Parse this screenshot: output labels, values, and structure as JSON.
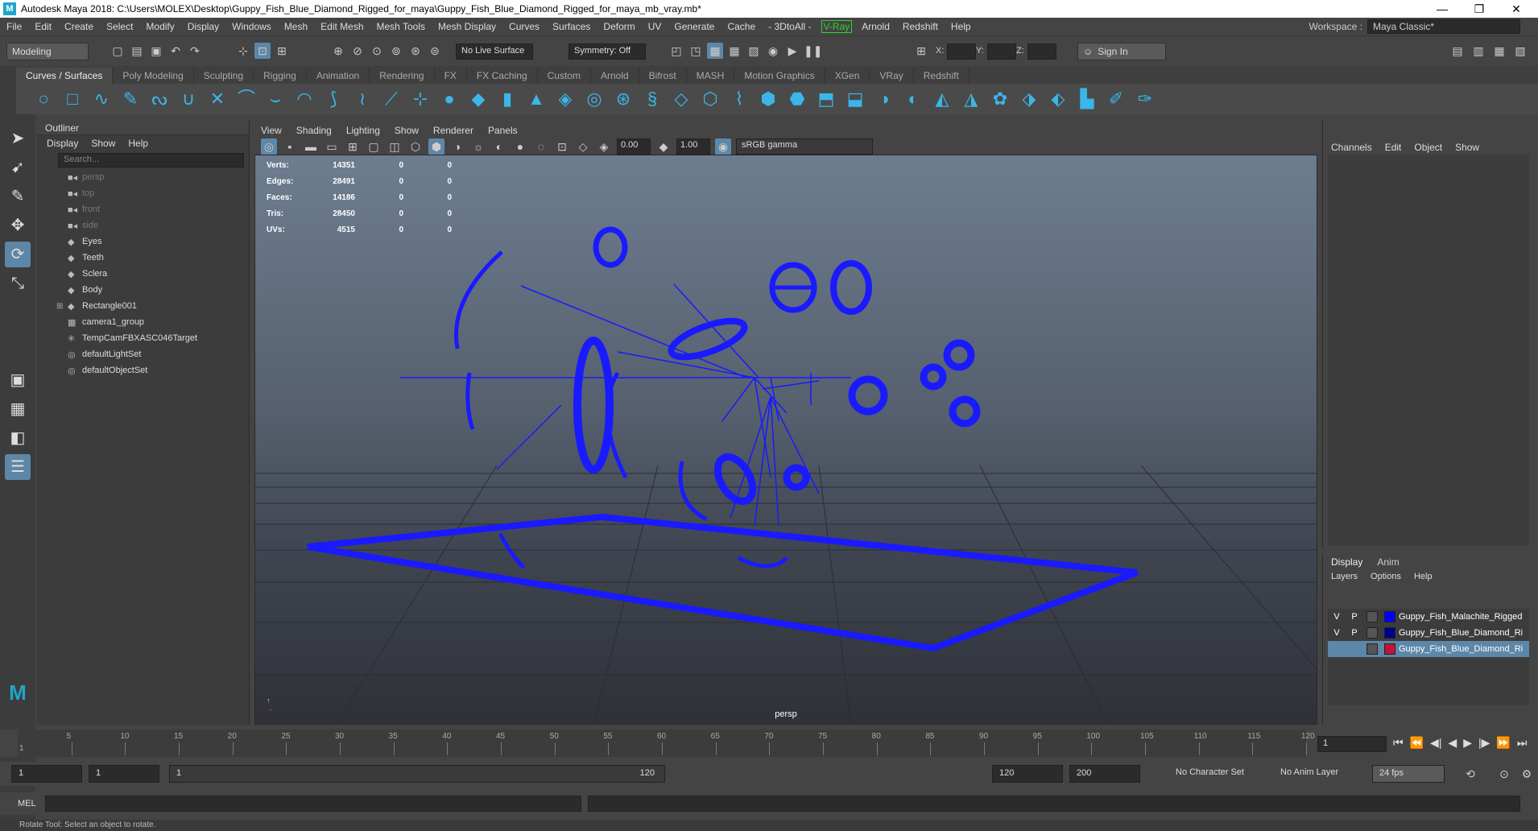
{
  "titlebar": {
    "title": "Autodesk Maya 2018: C:\\Users\\MOLEX\\Desktop\\Guppy_Fish_Blue_Diamond_Rigged_for_maya\\Guppy_Fish_Blue_Diamond_Rigged_for_maya_mb_vray.mb*",
    "minimize": "—",
    "restore": "❐",
    "close": "✕"
  },
  "menubar": {
    "items": [
      "File",
      "Edit",
      "Create",
      "Select",
      "Modify",
      "Display",
      "Windows",
      "Mesh",
      "Edit Mesh",
      "Mesh Tools",
      "Mesh Display",
      "Curves",
      "Surfaces",
      "Deform",
      "UV",
      "Generate",
      "Cache",
      "- 3DtoAll -",
      "V-Ray",
      "Arnold",
      "Redshift",
      "Help"
    ],
    "workspace_label": "Workspace :",
    "workspace_value": "Maya Classic*"
  },
  "statusline": {
    "mode": "Modeling",
    "live_surface": "No Live Surface",
    "symmetry": "Symmetry: Off",
    "x_label": "X:",
    "y_label": "Y:",
    "z_label": "Z:",
    "sign_in": "Sign In"
  },
  "shelf": {
    "tabs": [
      "Curves / Surfaces",
      "Poly Modeling",
      "Sculpting",
      "Rigging",
      "Animation",
      "Rendering",
      "FX",
      "FX Caching",
      "Custom",
      "Arnold",
      "Bifrost",
      "MASH",
      "Motion Graphics",
      "XGen",
      "VRay",
      "Redshift"
    ],
    "active_tab": "Curves / Surfaces"
  },
  "outliner": {
    "title": "Outliner",
    "menu": [
      "Display",
      "Show",
      "Help"
    ],
    "search_placeholder": "Search...",
    "items": [
      {
        "label": "persp",
        "dim": true,
        "icon": "camera-icon"
      },
      {
        "label": "top",
        "dim": true,
        "icon": "camera-icon"
      },
      {
        "label": "front",
        "dim": true,
        "icon": "camera-icon"
      },
      {
        "label": "side",
        "dim": true,
        "icon": "camera-icon"
      },
      {
        "label": "Eyes",
        "dim": false,
        "icon": "transform-icon"
      },
      {
        "label": "Teeth",
        "dim": false,
        "icon": "transform-icon"
      },
      {
        "label": "Sclera",
        "dim": false,
        "icon": "transform-icon"
      },
      {
        "label": "Body",
        "dim": false,
        "icon": "transform-icon"
      },
      {
        "label": "Rectangle001",
        "dim": false,
        "icon": "transform-icon",
        "expandable": true
      },
      {
        "label": "camera1_group",
        "dim": false,
        "icon": "group-icon"
      },
      {
        "label": "TempCamFBXASC046Target",
        "dim": false,
        "icon": "locator-icon"
      },
      {
        "label": "defaultLightSet",
        "dim": false,
        "icon": "set-icon"
      },
      {
        "label": "defaultObjectSet",
        "dim": false,
        "icon": "set-icon"
      }
    ]
  },
  "viewport": {
    "menu": [
      "View",
      "Shading",
      "Lighting",
      "Show",
      "Renderer",
      "Panels"
    ],
    "exposure": "0.00",
    "gamma": "1.00",
    "colorspace": "sRGB gamma",
    "camera_label": "persp",
    "hud": [
      {
        "label": "Verts:",
        "a": "14351",
        "b": "0",
        "c": "0"
      },
      {
        "label": "Edges:",
        "a": "28491",
        "b": "0",
        "c": "0"
      },
      {
        "label": "Faces:",
        "a": "14186",
        "b": "0",
        "c": "0"
      },
      {
        "label": "Tris:",
        "a": "28450",
        "b": "0",
        "c": "0"
      },
      {
        "label": "UVs:",
        "a": "4515",
        "b": "0",
        "c": "0"
      }
    ],
    "wire_color": "#1a1aff"
  },
  "channels": {
    "menu": [
      "Channels",
      "Edit",
      "Object",
      "Show"
    ]
  },
  "layers": {
    "tabs": [
      "Display",
      "Anim"
    ],
    "menu": [
      "Layers",
      "Options",
      "Help"
    ],
    "rows": [
      {
        "v": "V",
        "p": "P",
        "color": "#0000ff",
        "name": "Guppy_Fish_Malachite_Rigged",
        "selected": false
      },
      {
        "v": "V",
        "p": "P",
        "color": "#00008b",
        "name": "Guppy_Fish_Blue_Diamond_Ri",
        "selected": false
      },
      {
        "v": "",
        "p": "",
        "color": "#c0143c",
        "name": "Guppy_Fish_Blue_Diamond_Ri",
        "selected": true
      }
    ]
  },
  "timeslider": {
    "ticks": [
      "5",
      "10",
      "15",
      "20",
      "25",
      "30",
      "35",
      "40",
      "45",
      "50",
      "55",
      "60",
      "65",
      "70",
      "75",
      "80",
      "85",
      "90",
      "95",
      "100",
      "105",
      "110",
      "115",
      "120"
    ],
    "start_marker": "1",
    "current_frame": "1"
  },
  "rangeslider": {
    "start": "1",
    "start_inner": "1",
    "range_start": "1",
    "range_end": "120",
    "end_inner": "120",
    "end": "200",
    "character_set": "No Character Set",
    "anim_layer": "No Anim Layer",
    "fps": "24 fps"
  },
  "cmdline": {
    "label": "MEL"
  },
  "helpline": {
    "text": "Rotate Tool: Select an object to rotate."
  }
}
